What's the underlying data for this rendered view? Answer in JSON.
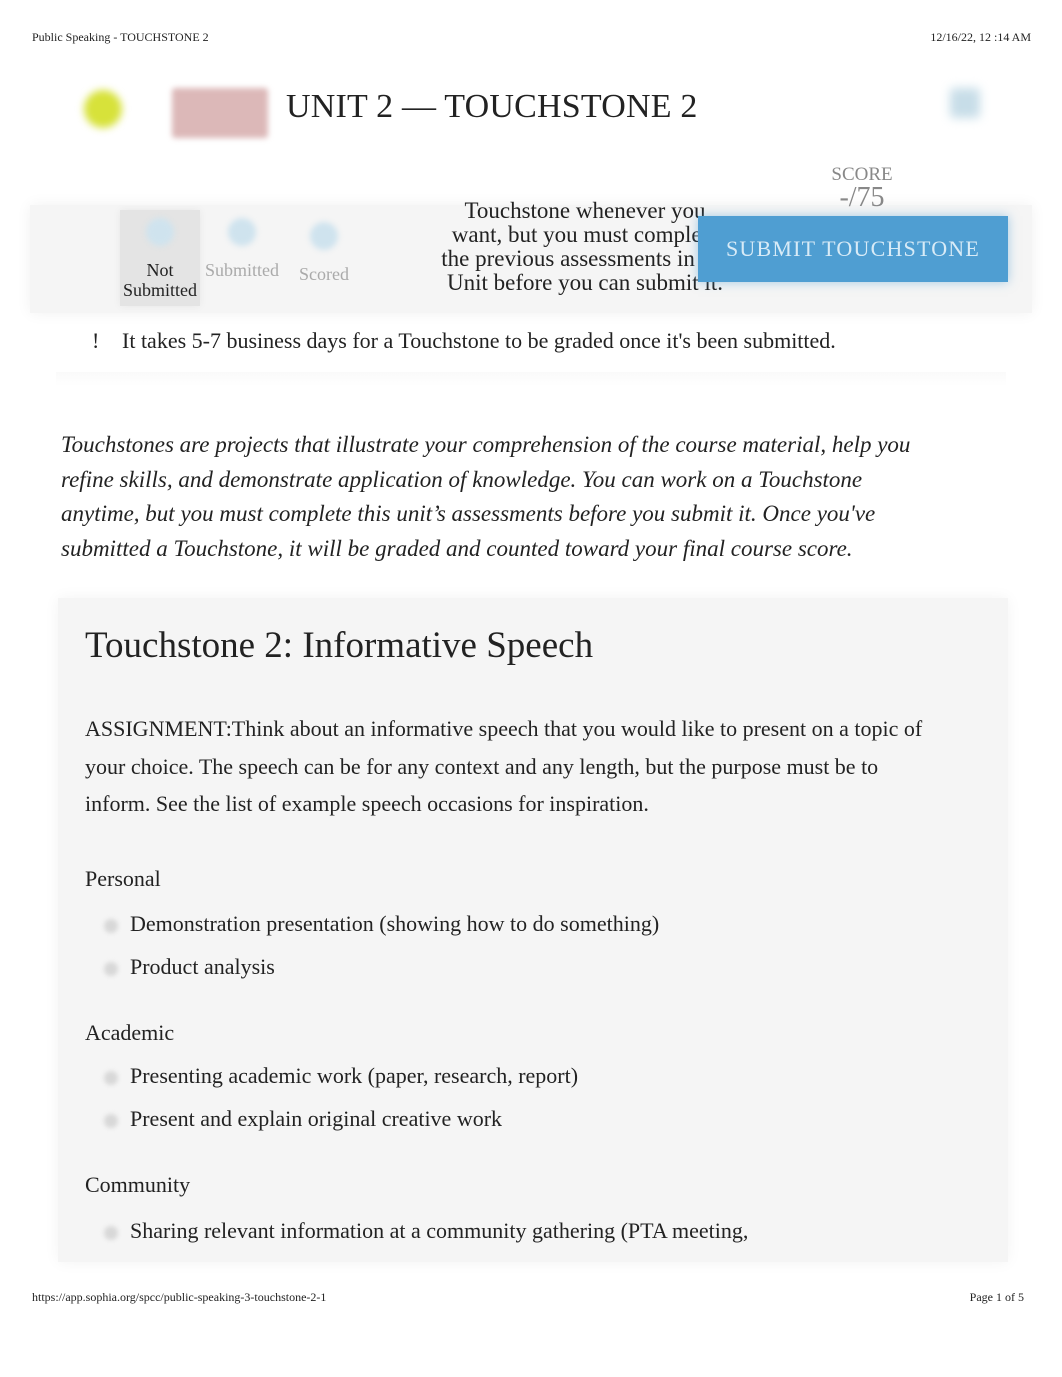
{
  "print_header": {
    "title": "Public Speaking - TOUCHSTONE 2",
    "datetime": "12/16/22, 12  :14 AM"
  },
  "header": {
    "unit_title": "UNIT 2 — TOUCHSTONE 2"
  },
  "status": {
    "steps": [
      {
        "label": "Not Submitted",
        "active": true
      },
      {
        "label": "Submitted",
        "active": false
      },
      {
        "label": "Scored",
        "active": false
      }
    ],
    "tooltip": "Touchstone whenever you want, but you must complete the previous assessments in the Unit before you can submit it.",
    "score_label": "SCORE",
    "score_value": "-/75",
    "submit_label": "SUBMIT TOUCHSTONE",
    "submit_color": "#4f9ed2"
  },
  "notice": {
    "icon": "!",
    "text": "It takes 5-7 business days for a Touchstone to be graded once it's been submitted."
  },
  "intro": "Touchstones are projects that illustrate your comprehension of the course material, help you refine skills, and demonstrate application of knowledge. You can work on a Touchstone anytime, but you must complete this unit’s assessments before you submit it. Once you've submitted a Touchstone, it will be graded and counted toward your final course score.",
  "card": {
    "title": "Touchstone 2: Informative Speech",
    "assignment": "ASSIGNMENT:Think about an informative speech that you would like to present on a topic of your choice. The speech can be for any context and any length, but the purpose must be to inform. See the list of example speech occasions for inspiration.",
    "categories": [
      {
        "name": "Personal",
        "items": [
          "Demonstration presentation (showing how to do something)",
          "Product analysis"
        ]
      },
      {
        "name": "Academic",
        "items": [
          "Presenting academic work (paper, research, report)",
          "Present and explain original creative work"
        ]
      },
      {
        "name": "Community",
        "items": [
          "Sharing relevant information at a community gathering (PTA meeting,"
        ]
      }
    ]
  },
  "print_footer": {
    "url": "https://app.sophia.org/spcc/public-speaking-3-touchstone-2-1",
    "page": "Page 1 of 5"
  }
}
